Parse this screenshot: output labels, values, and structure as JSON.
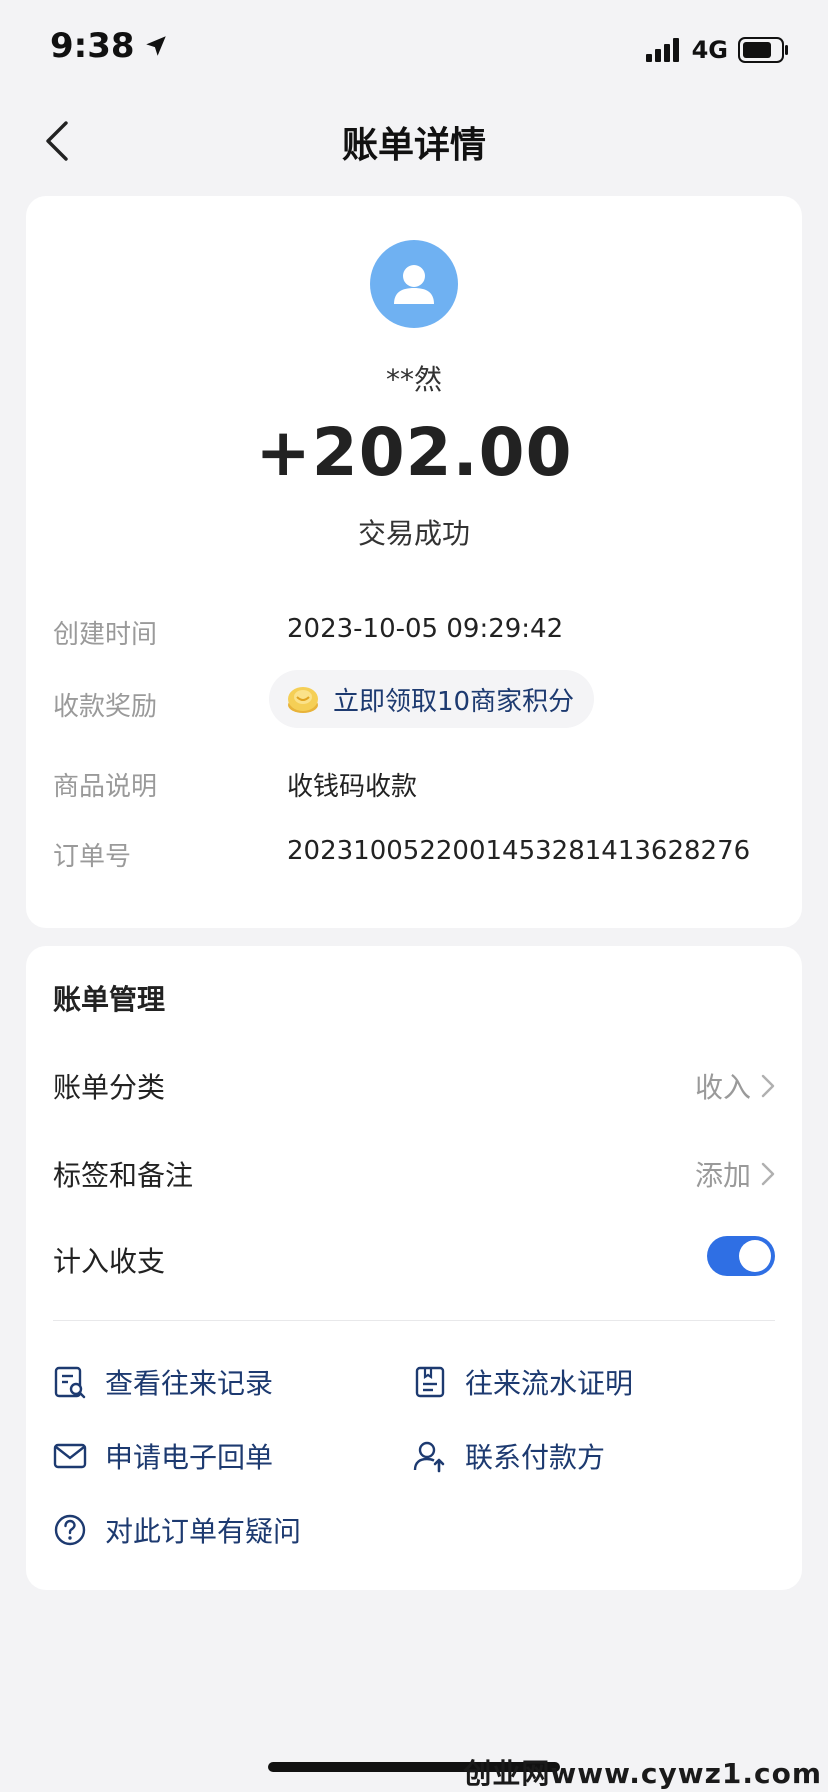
{
  "status_bar": {
    "time": "9:38",
    "network": "4G"
  },
  "nav": {
    "title": "账单详情"
  },
  "detail": {
    "payer_name": "**然",
    "amount": "+202.00",
    "status": "交易成功",
    "rows": [
      {
        "label": "创建时间",
        "value": "2023-10-05 09:29:42"
      },
      {
        "label": "收款奖励",
        "value": "立即领取10商家积分"
      },
      {
        "label": "商品说明",
        "value": "收钱码收款"
      },
      {
        "label": "订单号",
        "value": "2023100522001453281413628276"
      }
    ]
  },
  "manage": {
    "title": "账单管理",
    "category": {
      "label": "账单分类",
      "value": "收入"
    },
    "tags": {
      "label": "标签和备注",
      "value": "添加"
    },
    "include": {
      "label": "计入收支",
      "enabled": true
    },
    "actions": [
      {
        "label": "查看往来记录",
        "icon": "records-search-icon"
      },
      {
        "label": "往来流水证明",
        "icon": "statement-doc-icon"
      },
      {
        "label": "申请电子回单",
        "icon": "envelope-icon"
      },
      {
        "label": "联系付款方",
        "icon": "contact-user-icon"
      },
      {
        "label": "对此订单有疑问",
        "icon": "question-icon"
      }
    ]
  },
  "watermark": "创业网www.cywz1.com",
  "colors": {
    "accent": "#2f6fe4",
    "link": "#1d3a70",
    "avatar": "#6fb1f2",
    "background": "#f3f3f5"
  }
}
